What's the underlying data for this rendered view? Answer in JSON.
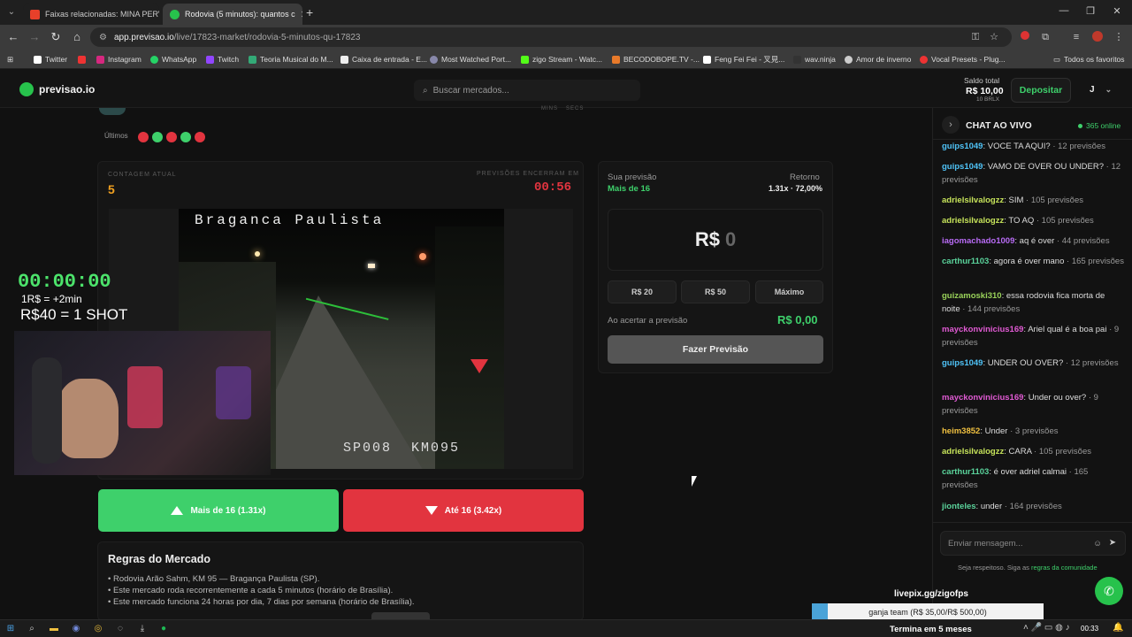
{
  "browser": {
    "tabs": [
      {
        "label": "Faixas relacionadas: MINA PERV",
        "active": false
      },
      {
        "label": "Rodovia (5 minutos): quantos c",
        "active": true
      }
    ],
    "url_domain": "app.previsao.io",
    "url_path": "/live/17823-market/rodovia-5-minutos-qu-17823",
    "bookmarks": [
      "Twitter",
      "Instagram",
      "WhatsApp",
      "Twitch",
      "Teoria Musical do M...",
      "Caixa de entrada - E...",
      "Most Watched Port...",
      "zigo Stream - Watc...",
      "BECODOBOPE.TV -...",
      "Feng Fei Fei - 叉見...",
      "wav.ninja",
      "Amor de inverno",
      "Vocal Presets - Plug..."
    ],
    "all_bookmarks": "Todos os favoritos"
  },
  "site": {
    "logo": "previsao.io",
    "search_placeholder": "Buscar mercados...",
    "balance_label": "Saldo total",
    "balance_value": "R$ 10,00",
    "balance_sub": "10 BRLX",
    "deposit": "Depositar",
    "user_initial": "J"
  },
  "market": {
    "timer_labels": [
      "MINS",
      "SECS"
    ],
    "last_label": "Últimos",
    "last_results": [
      "down",
      "up",
      "down",
      "up",
      "down"
    ],
    "count_label": "CONTAGEM ATUAL",
    "count_value": "5",
    "close_label": "PREVISÕES ENCERRAM EM",
    "close_value": "00:56",
    "camera_title": "Braganca Paulista",
    "camera_footer": "SP008  KM095",
    "up_button": "Mais de 16 (1.31x)",
    "down_button": "Até 16 (3.42x)"
  },
  "stream_overlay": {
    "timer": "00:00:00",
    "line1": "1R$ = +2min",
    "line2": "R$40 = 1 SHOT",
    "livepix": "livepix.gg/zigofps",
    "goal": "ganja team (R$ 35,00/R$ 500,00)",
    "goal_progress": 0.07,
    "ends": "Termina em 5 meses"
  },
  "bet": {
    "your_pick_label": "Sua previsão",
    "your_pick": "Mais de 16",
    "return_label": "Retorno",
    "return_value": "1.31x · 72,00%",
    "currency": "R$",
    "amount": "0",
    "quick": [
      "R$ 20",
      "R$ 50",
      "Máximo"
    ],
    "payout_label": "Ao acertar a previsão",
    "payout_value": "R$ 0,00",
    "submit": "Fazer Previsão"
  },
  "rules": {
    "title": "Regras do Mercado",
    "items": [
      "• Rodovia Arão Sahm, KM 95 — Bragança Paulista (SP).",
      "• Este mercado roda recorrentemente a cada 5 minutos (horário de Brasília).",
      "• Este mercado funciona 24 horas por dia, 7 dias por semana (horário de Brasília)."
    ]
  },
  "chat": {
    "title": "CHAT AO VIVO",
    "online": "365 online",
    "messages": [
      {
        "user": "guips1049",
        "text": "VOCE TA AQUI?",
        "meta": "· 12 previsões",
        "color": "#4fc3f7"
      },
      {
        "user": "guips1049",
        "text": "VAMO DE OVER OU UNDER?",
        "meta": "· 12 previsões",
        "color": "#4fc3f7"
      },
      {
        "user": "adrielsilvalogzz",
        "text": "SIM",
        "meta": "· 105 previsões",
        "color": "#c6e35a"
      },
      {
        "user": "adrielsilvalogzz",
        "text": "TO AQ",
        "meta": "· 105 previsões",
        "color": "#c6e35a"
      },
      {
        "user": "iagomachado1009",
        "text": "aq é over",
        "meta": "· 44 previsões",
        "color": "#b86bf5"
      },
      {
        "user": "carthur1103",
        "text": "agora é over mano",
        "meta": "· 165 previsões",
        "color": "#5ad39b"
      },
      {
        "user": "guizamoski310",
        "text": "essa rodovia fica morta de noite",
        "meta": "· 144 previsões",
        "color": "#9ad35a"
      },
      {
        "user": "mayckonvinicius169",
        "text": "Ariel qual é a boa pai",
        "meta": "· 9 previsões",
        "color": "#e05ad3"
      },
      {
        "user": "guips1049",
        "text": "UNDER OU OVER?",
        "meta": "· 12 previsões",
        "color": "#4fc3f7"
      },
      {
        "user": "mayckonvinicius169",
        "text": "Under ou over?",
        "meta": "· 9 previsões",
        "color": "#e05ad3"
      },
      {
        "user": "heim3852",
        "text": "Under",
        "meta": "· 3 previsões",
        "color": "#f0c040"
      },
      {
        "user": "adrielsilvalogzz",
        "text": "CARA",
        "meta": "· 105 previsões",
        "color": "#c6e35a"
      },
      {
        "user": "carthur1103",
        "text": "é over adriel calmai",
        "meta": "· 165 previsões",
        "color": "#5ad39b"
      },
      {
        "user": "jionteles",
        "text": "under",
        "meta": "· 164 previsões",
        "color": "#5ad39b"
      }
    ],
    "input_placeholder": "Enviar mensagem...",
    "footer": "Seja respeitoso. Siga as",
    "footer_link": "regras da comunidade"
  },
  "taskbar": {
    "time": "00:33"
  },
  "colors": {
    "accent": "#27c24c",
    "up": "#3ed06b",
    "down": "#e2343f",
    "count": "#f0a020"
  }
}
